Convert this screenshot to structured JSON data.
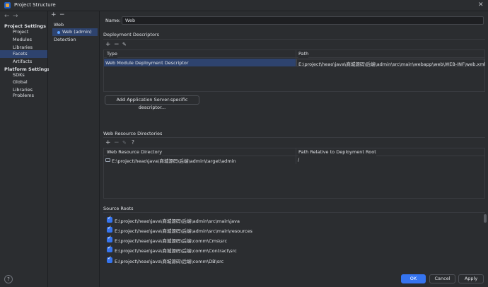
{
  "window": {
    "title": "Project Structure",
    "close": "✕"
  },
  "nav": {
    "back": "←",
    "forward": "→",
    "project_settings": "Project Settings",
    "project_items": [
      "Project",
      "Modules",
      "Libraries",
      "Facets",
      "Artifacts"
    ],
    "platform_settings": "Platform Settings",
    "platform_items": [
      "SDKs",
      "Global Libraries"
    ],
    "problems": "Problems"
  },
  "facets": {
    "add": "+",
    "remove": "−",
    "web": "Web",
    "web_admin": "Web (admin)",
    "detection": "Detection"
  },
  "name_field": {
    "label": "Name:",
    "value": "Web"
  },
  "deployment": {
    "title": "Deployment Descriptors",
    "toolbar": {
      "add": "+",
      "remove": "−",
      "edit": "✎"
    },
    "col_type": "Type",
    "col_path": "Path",
    "row_type": "Web Module Deployment Descriptor",
    "row_path": "E:\\project\\heao\\java\\商城源码\\后端\\admin\\src\\main\\webapp\\web\\WEB-INF\\web.xml",
    "add_server_button": "Add Application Server-specific descriptor..."
  },
  "resources": {
    "title": "Web Resource Directories",
    "toolbar": {
      "add": "+",
      "remove": "−",
      "edit": "✎",
      "help": "?"
    },
    "col_dir": "Web Resource Directory",
    "col_rel": "Path Relative to Deployment Root",
    "row_dir": "E:\\project\\heao\\java\\商城源码\\后端\\admin\\target\\admin",
    "row_rel": "/"
  },
  "source_roots": {
    "title": "Source Roots",
    "items": [
      "E:\\project\\heao\\java\\商城源码\\后端\\admin\\src\\main\\java",
      "E:\\project\\heao\\java\\商城源码\\后端\\admin\\src\\main\\resources",
      "E:\\project\\heao\\java\\商城源码\\后端\\comm\\Cms\\src",
      "E:\\project\\heao\\java\\商城源码\\后端\\comm\\Contract\\src",
      "E:\\project\\heao\\java\\商城源码\\后端\\comm\\DB\\src"
    ]
  },
  "footer": {
    "help": "?",
    "ok": "OK",
    "cancel": "Cancel",
    "apply": "Apply"
  }
}
